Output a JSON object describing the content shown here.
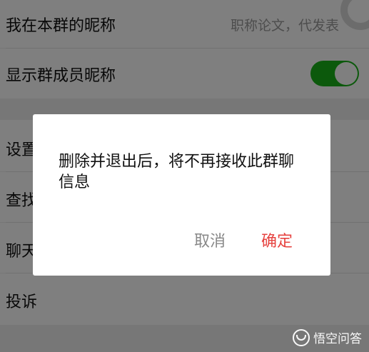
{
  "settings": {
    "nickname_row": {
      "label": "我在本群的昵称",
      "value": "职称论文，代发表"
    },
    "show_nicknames_row": {
      "label": "显示群成员昵称",
      "toggle_on": true
    },
    "set_row": {
      "label": "设置"
    },
    "find_row": {
      "label": "查找"
    },
    "chat_row": {
      "label": "聊天"
    },
    "complaint_row": {
      "label": "投诉"
    }
  },
  "dialog": {
    "message": "删除并退出后，将不再接收此群聊信息",
    "cancel_label": "取消",
    "confirm_label": "确定"
  },
  "watermark": {
    "text": "悟空问答"
  },
  "colors": {
    "toggle_on": "#18b318",
    "confirm": "#e64340",
    "cancel": "#888888"
  }
}
